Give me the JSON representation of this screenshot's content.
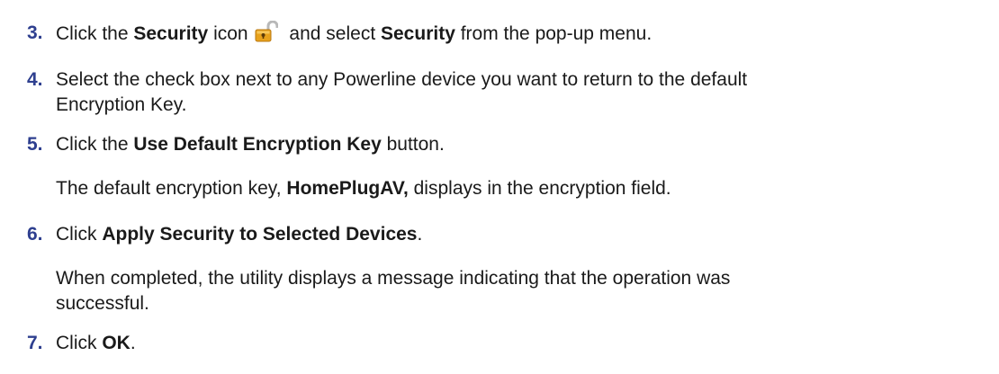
{
  "steps": [
    {
      "number": "3.",
      "parts": [
        "Click the ",
        "Security",
        " icon",
        " and select ",
        "Security",
        " from the pop-up menu."
      ],
      "icon": "security-lock-icon"
    },
    {
      "number": "4.",
      "line1": "Select the check box next to any Powerline device you want to return to the default",
      "line2": "Encryption Key."
    },
    {
      "number": "5.",
      "parts": [
        "Click the ",
        "Use Default Encryption Key",
        " button."
      ]
    },
    {
      "number": "6.",
      "parts": [
        "Click ",
        "Apply Security to Selected Devices",
        "."
      ]
    },
    {
      "number": "7.",
      "parts": [
        "Click ",
        "OK",
        "."
      ]
    }
  ],
  "notes": {
    "default_key": {
      "parts": [
        "The default encryption key, ",
        "HomePlugAV,",
        " displays in the encryption field."
      ]
    },
    "completion": {
      "line1": "When completed, the utility displays a message indicating that the operation was",
      "line2": "successful."
    }
  },
  "colors": {
    "step_number": "#2e3f8f",
    "lock_body": "#e8a21c",
    "lock_shackle": "#b8b8b8"
  }
}
